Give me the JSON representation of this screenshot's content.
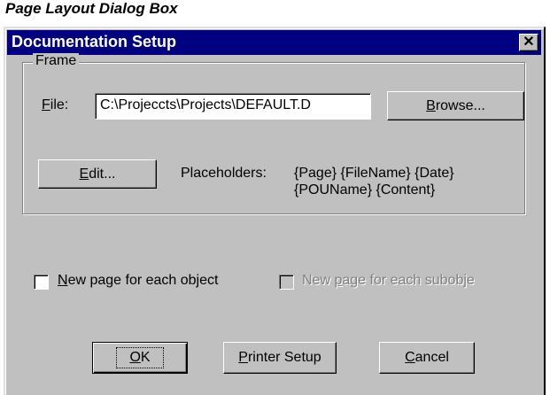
{
  "caption": "Page Layout Dialog Box",
  "dialog": {
    "title": "Documentation Setup",
    "close_glyph": "✕"
  },
  "frame": {
    "group_label": "Frame",
    "file_label_mn": "F",
    "file_label_rest": "ile:",
    "file_value": "C:\\Projeccts\\Projects\\DEFAULT.D",
    "browse_mn": "B",
    "browse_rest": "rowse...",
    "edit_mn": "E",
    "edit_rest": "dit...",
    "placeholders_label": "Placeholders:",
    "placeholders_line1": "{Page} {FileName} {Date}",
    "placeholders_line2": "{POUName} {Content}"
  },
  "options": {
    "new_page_object_mn": "N",
    "new_page_object_rest": "ew page for each object",
    "new_page_object_checked": false,
    "new_page_subobject_a": "New ",
    "new_page_subobject_mn": "p",
    "new_page_subobject_b": "age for each subobje",
    "new_page_subobject_checked": false,
    "new_page_subobject_enabled": false
  },
  "buttons": {
    "ok_mn": "O",
    "ok_rest": "K",
    "printer_mn": "P",
    "printer_rest": "rinter Setup",
    "cancel_mn": "C",
    "cancel_rest": "ancel"
  },
  "icons": [
    "close-icon"
  ],
  "colors": {
    "titlebar": "#000080",
    "face": "#c0c0c0",
    "field": "#ffffff"
  }
}
